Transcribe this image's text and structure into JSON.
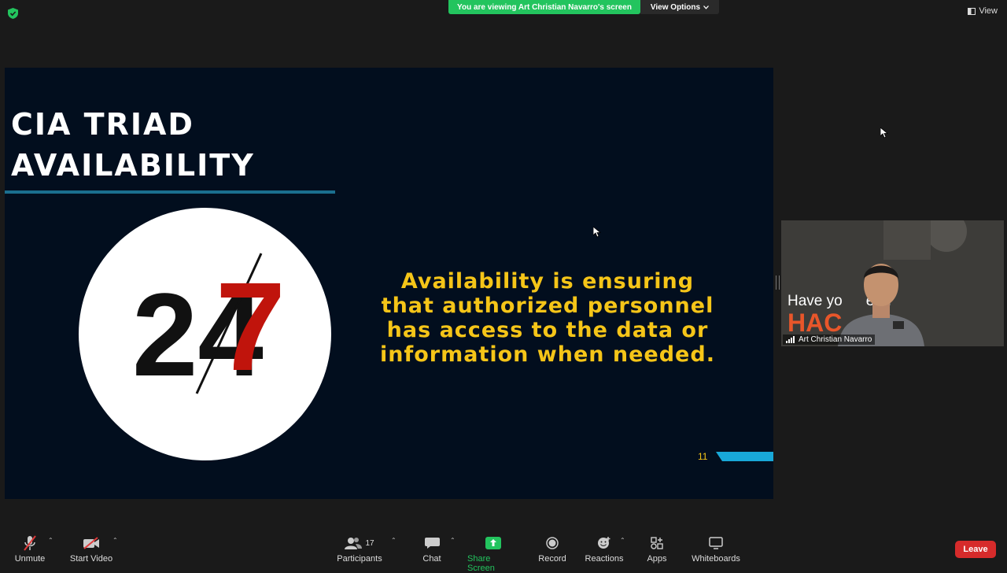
{
  "topbar": {
    "viewing_banner": "You are viewing Art Christian Navarro's screen",
    "view_options": "View Options",
    "view_button": "View"
  },
  "slide": {
    "title_line1": "CIA TRIAD",
    "title_line2": "AVAILABILITY",
    "logo_text_a": "24",
    "logo_text_b": "7",
    "body_line1": "Availability is ensuring",
    "body_line2": "that authorized personnel",
    "body_line3": "has access to the data or",
    "body_line4": "information when needed.",
    "page_number": "11",
    "accent_yellow": "#f5c518",
    "accent_red": "#c0140c"
  },
  "video": {
    "participant_name": "Art Christian Navarro",
    "background_text_1": "Have yo",
    "background_text_1b": "een",
    "background_text_2": "HAC"
  },
  "toolbar": {
    "unmute": "Unmute",
    "start_video": "Start Video",
    "participants": "Participants",
    "participants_count": "17",
    "chat": "Chat",
    "share_screen": "Share Screen",
    "record": "Record",
    "reactions": "Reactions",
    "apps": "Apps",
    "whiteboards": "Whiteboards",
    "leave": "Leave"
  },
  "icons": [
    "shield-icon",
    "chevron-down-icon",
    "view-icon",
    "mic-muted-icon",
    "video-off-icon",
    "participants-icon",
    "chat-icon",
    "share-screen-icon",
    "record-icon",
    "reactions-icon",
    "apps-icon",
    "whiteboard-icon",
    "caret-up-icon",
    "cursor-icon",
    "signal-icon"
  ]
}
